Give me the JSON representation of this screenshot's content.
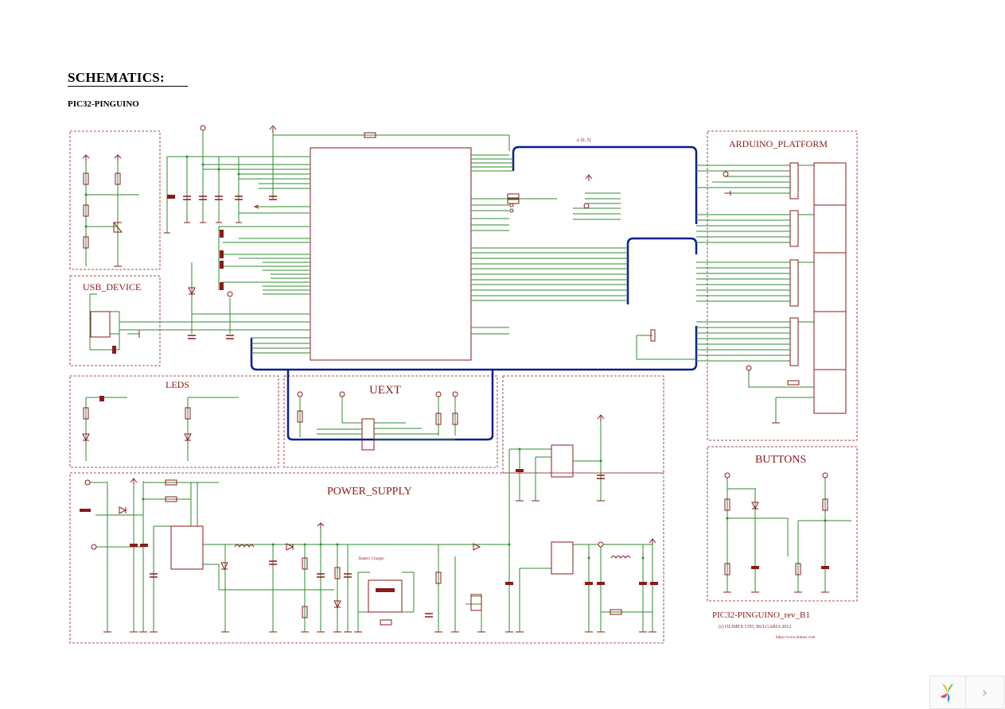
{
  "heading": "SCHEMATICS:",
  "subheading": "PIC32-PINGUINO",
  "blocks": {
    "usb_device": "USB_DEVICE",
    "leds": "LEDS",
    "uext": "UEXT",
    "power_supply": "POWER_SUPPLY",
    "arduino_platform": "ARDUINO_PLATFORM",
    "buttons": "BUTTONS"
  },
  "revision": "PIC32-PINGUINO_rev_B1",
  "company": "(c) OLIMEX LTD, BULGARIA 2012",
  "website": "https://www.olimex.com",
  "bus_label": "A [0..5]",
  "battery_label": "Battery Charger",
  "colors": {
    "wire": "#2e8b2e",
    "component": "#8b1a1a",
    "frame": "#8b1a1a",
    "bus": "#0a1f8f"
  },
  "nav": {
    "logo_icon": "yumpu-logo-icon",
    "next_icon": "chevron-right-icon",
    "next_glyph": "›"
  }
}
